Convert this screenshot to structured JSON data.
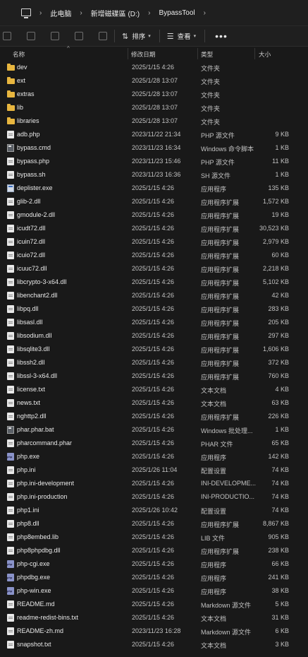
{
  "breadcrumb": [
    "此电脑",
    "新增磁碟區 (D:)",
    "BypassTool"
  ],
  "toolbar": {
    "sort_label": "排序",
    "view_label": "查看",
    "more_label": "•••"
  },
  "columns": {
    "name": "名称",
    "date": "修改日期",
    "type": "类型",
    "size": "大小"
  },
  "files": [
    {
      "name": "dev",
      "date": "2025/1/15 4:26",
      "type": "文件夹",
      "size": "",
      "icon": "folder"
    },
    {
      "name": "ext",
      "date": "2025/1/28 13:07",
      "type": "文件夹",
      "size": "",
      "icon": "folder"
    },
    {
      "name": "extras",
      "date": "2025/1/28 13:07",
      "type": "文件夹",
      "size": "",
      "icon": "folder"
    },
    {
      "name": "lib",
      "date": "2025/1/28 13:07",
      "type": "文件夹",
      "size": "",
      "icon": "folder"
    },
    {
      "name": "libraries",
      "date": "2025/1/28 13:07",
      "type": "文件夹",
      "size": "",
      "icon": "folder"
    },
    {
      "name": "adb.php",
      "date": "2023/11/22 21:34",
      "type": "PHP 源文件",
      "size": "9 KB",
      "icon": "file"
    },
    {
      "name": "bypass.cmd",
      "date": "2023/11/23 16:34",
      "type": "Windows 命令脚本",
      "size": "1 KB",
      "icon": "cmd"
    },
    {
      "name": "bypass.php",
      "date": "2023/11/23 15:46",
      "type": "PHP 源文件",
      "size": "11 KB",
      "icon": "file"
    },
    {
      "name": "bypass.sh",
      "date": "2023/11/23 16:36",
      "type": "SH 源文件",
      "size": "1 KB",
      "icon": "file"
    },
    {
      "name": "deplister.exe",
      "date": "2025/1/15 4:26",
      "type": "应用程序",
      "size": "135 KB",
      "icon": "exe"
    },
    {
      "name": "glib-2.dll",
      "date": "2025/1/15 4:26",
      "type": "应用程序扩展",
      "size": "1,572 KB",
      "icon": "file"
    },
    {
      "name": "gmodule-2.dll",
      "date": "2025/1/15 4:26",
      "type": "应用程序扩展",
      "size": "19 KB",
      "icon": "file"
    },
    {
      "name": "icudt72.dll",
      "date": "2025/1/15 4:26",
      "type": "应用程序扩展",
      "size": "30,523 KB",
      "icon": "file"
    },
    {
      "name": "icuin72.dll",
      "date": "2025/1/15 4:26",
      "type": "应用程序扩展",
      "size": "2,979 KB",
      "icon": "file"
    },
    {
      "name": "icuio72.dll",
      "date": "2025/1/15 4:26",
      "type": "应用程序扩展",
      "size": "60 KB",
      "icon": "file"
    },
    {
      "name": "icuuc72.dll",
      "date": "2025/1/15 4:26",
      "type": "应用程序扩展",
      "size": "2,218 KB",
      "icon": "file"
    },
    {
      "name": "libcrypto-3-x64.dll",
      "date": "2025/1/15 4:26",
      "type": "应用程序扩展",
      "size": "5,102 KB",
      "icon": "file"
    },
    {
      "name": "libenchant2.dll",
      "date": "2025/1/15 4:26",
      "type": "应用程序扩展",
      "size": "42 KB",
      "icon": "file"
    },
    {
      "name": "libpq.dll",
      "date": "2025/1/15 4:26",
      "type": "应用程序扩展",
      "size": "283 KB",
      "icon": "file"
    },
    {
      "name": "libsasl.dll",
      "date": "2025/1/15 4:26",
      "type": "应用程序扩展",
      "size": "205 KB",
      "icon": "file"
    },
    {
      "name": "libsodium.dll",
      "date": "2025/1/15 4:26",
      "type": "应用程序扩展",
      "size": "297 KB",
      "icon": "file"
    },
    {
      "name": "libsqlite3.dll",
      "date": "2025/1/15 4:26",
      "type": "应用程序扩展",
      "size": "1,606 KB",
      "icon": "file"
    },
    {
      "name": "libssh2.dll",
      "date": "2025/1/15 4:26",
      "type": "应用程序扩展",
      "size": "372 KB",
      "icon": "file"
    },
    {
      "name": "libssl-3-x64.dll",
      "date": "2025/1/15 4:26",
      "type": "应用程序扩展",
      "size": "760 KB",
      "icon": "file"
    },
    {
      "name": "license.txt",
      "date": "2025/1/15 4:26",
      "type": "文本文档",
      "size": "4 KB",
      "icon": "file"
    },
    {
      "name": "news.txt",
      "date": "2025/1/15 4:26",
      "type": "文本文档",
      "size": "63 KB",
      "icon": "file"
    },
    {
      "name": "nghttp2.dll",
      "date": "2025/1/15 4:26",
      "type": "应用程序扩展",
      "size": "226 KB",
      "icon": "file"
    },
    {
      "name": "phar.phar.bat",
      "date": "2025/1/15 4:26",
      "type": "Windows 批处理...",
      "size": "1 KB",
      "icon": "cmd"
    },
    {
      "name": "pharcommand.phar",
      "date": "2025/1/15 4:26",
      "type": "PHAR 文件",
      "size": "65 KB",
      "icon": "file"
    },
    {
      "name": "php.exe",
      "date": "2025/1/15 4:26",
      "type": "应用程序",
      "size": "142 KB",
      "icon": "php"
    },
    {
      "name": "php.ini",
      "date": "2025/1/26 11:04",
      "type": "配置设置",
      "size": "74 KB",
      "icon": "file"
    },
    {
      "name": "php.ini-development",
      "date": "2025/1/15 4:26",
      "type": "INI-DEVELOPME...",
      "size": "74 KB",
      "icon": "file"
    },
    {
      "name": "php.ini-production",
      "date": "2025/1/15 4:26",
      "type": "INI-PRODUCTIO...",
      "size": "74 KB",
      "icon": "file"
    },
    {
      "name": "php1.ini",
      "date": "2025/1/26 10:42",
      "type": "配置设置",
      "size": "74 KB",
      "icon": "file"
    },
    {
      "name": "php8.dll",
      "date": "2025/1/15 4:26",
      "type": "应用程序扩展",
      "size": "8,867 KB",
      "icon": "file"
    },
    {
      "name": "php8embed.lib",
      "date": "2025/1/15 4:26",
      "type": "LIB 文件",
      "size": "905 KB",
      "icon": "file"
    },
    {
      "name": "php8phpdbg.dll",
      "date": "2025/1/15 4:26",
      "type": "应用程序扩展",
      "size": "238 KB",
      "icon": "file"
    },
    {
      "name": "php-cgi.exe",
      "date": "2025/1/15 4:26",
      "type": "应用程序",
      "size": "66 KB",
      "icon": "php"
    },
    {
      "name": "phpdbg.exe",
      "date": "2025/1/15 4:26",
      "type": "应用程序",
      "size": "241 KB",
      "icon": "php"
    },
    {
      "name": "php-win.exe",
      "date": "2025/1/15 4:26",
      "type": "应用程序",
      "size": "38 KB",
      "icon": "php"
    },
    {
      "name": "README.md",
      "date": "2025/1/15 4:26",
      "type": "Markdown 源文件",
      "size": "5 KB",
      "icon": "file"
    },
    {
      "name": "readme-redist-bins.txt",
      "date": "2025/1/15 4:26",
      "type": "文本文档",
      "size": "31 KB",
      "icon": "file"
    },
    {
      "name": "README-zh.md",
      "date": "2023/11/23 16:28",
      "type": "Markdown 源文件",
      "size": "6 KB",
      "icon": "file"
    },
    {
      "name": "snapshot.txt",
      "date": "2025/1/15 4:26",
      "type": "文本文档",
      "size": "3 KB",
      "icon": "file"
    }
  ]
}
